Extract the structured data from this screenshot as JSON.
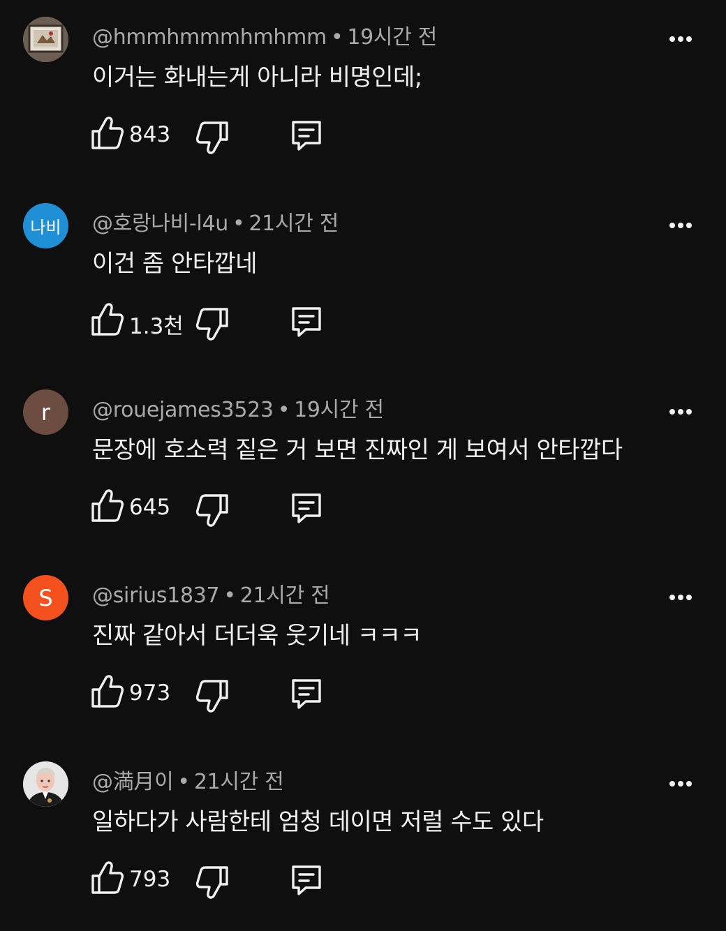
{
  "comments": [
    {
      "author": "@hmmhmmmhmhmm",
      "time": "19시간 전",
      "text": "이거는 화내는게 아니라 비명인데;",
      "likes": "843",
      "avatar": {
        "kind": "image",
        "bg": "#8a7a6a",
        "icon": "framed-picture-avatar"
      }
    },
    {
      "author": "@호랑나비-l4u",
      "time": "21시간 전",
      "text": "이건 좀 안타깝네",
      "likes": "1.3천",
      "avatar": {
        "kind": "text",
        "label": "나비",
        "bg": "#1f8fd6"
      }
    },
    {
      "author": "@rouejames3523",
      "time": "19시간 전",
      "text": "문장에 호소력 짙은 거 보면 진짜인 게 보여서 안타깝다",
      "likes": "645",
      "avatar": {
        "kind": "text",
        "label": "r",
        "bg": "#6d4c41"
      }
    },
    {
      "author": "@sirius1837",
      "time": "21시간 전",
      "text": "진짜 같아서 더더욱 웃기네 ㅋㅋㅋ",
      "likes": "973",
      "avatar": {
        "kind": "text",
        "label": "S",
        "bg": "#f4511e"
      }
    },
    {
      "author": "@満月이",
      "time": "21시간 전",
      "text": "일하다가 사람한테 엄청 데이면 저럴 수도 있다",
      "likes": "793",
      "avatar": {
        "kind": "image",
        "bg": "#dcdcdc",
        "icon": "person-portrait-avatar"
      }
    }
  ],
  "separator": "•",
  "colors": {
    "background": "#0f0f0f",
    "text": "#f1f1f1",
    "meta": "#aaaaaa"
  },
  "icons": {
    "like": "thumb-up-icon",
    "dislike": "thumb-down-icon",
    "reply": "comment-icon",
    "more": "more-vert-icon"
  }
}
